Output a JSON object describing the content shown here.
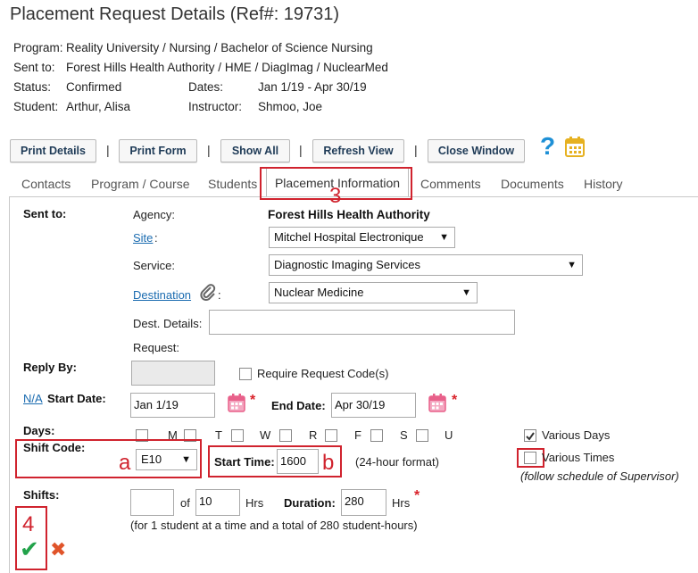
{
  "header": {
    "title": "Placement Request Details (Ref#: 19731)",
    "program_label": "Program:",
    "program_value": "Reality University / Nursing / Bachelor of Science Nursing",
    "sent_label": "Sent to:",
    "sent_value": "Forest Hills Health Authority / HME / DiagImag / NuclearMed",
    "status_label": "Status:",
    "status_value": "Confirmed",
    "dates_label": "Dates:",
    "dates_value": "Jan 1/19 - Apr 30/19",
    "student_label": "Student:",
    "student_value": "Arthur, Alisa",
    "instructor_label": "Instructor:",
    "instructor_value": "Shmoo, Joe"
  },
  "toolbar": {
    "print_details": "Print Details",
    "print_form": "Print Form",
    "show_all": "Show All",
    "refresh_view": "Refresh View",
    "close_window": "Close Window",
    "separator": "|",
    "help_glyph": "?"
  },
  "tabs": [
    "Contacts",
    "Program / Course",
    "Students",
    "Placement Information",
    "Comments",
    "Documents",
    "History"
  ],
  "form": {
    "sent_to_label": "Sent to:",
    "agency_label": "Agency:",
    "agency_value": "Forest Hills Health Authority",
    "site_label": "Site",
    "site_value": "Mitchel Hospital Electronique",
    "service_label": "Service:",
    "service_value": "Diagnostic Imaging Services",
    "destination_label": "Destination",
    "destination_colon": ":",
    "destination_value": "Nuclear Medicine",
    "dest_details_label": "Dest. Details:",
    "dest_details_value": "",
    "request_label": "Request:",
    "reply_by_label": "Reply By:",
    "require_code_label": "Require Request Code(s)",
    "na_link": "N/A",
    "start_date_label": "Start Date:",
    "start_date_value": "Jan 1/19",
    "end_date_label": "End Date:",
    "end_date_value": "Apr 30/19",
    "days_label": "Days:",
    "days": [
      "M",
      "T",
      "W",
      "R",
      "F",
      "S",
      "U"
    ],
    "various_days_label": "Various Days",
    "various_days_checked": true,
    "shift_code_label": "Shift Code:",
    "shift_code_value": "E10",
    "start_time_label": "Start Time:",
    "start_time_value": "1600",
    "time_format": "(24-hour format)",
    "various_times_label": "Various Times",
    "various_times_checked": false,
    "various_times_note": "(follow schedule of Supervisor)",
    "shifts_label": "Shifts:",
    "shifts_value": "",
    "of_label": "of",
    "hours_value": "10",
    "hrs_label": "Hrs",
    "duration_label": "Duration:",
    "duration_value": "280",
    "duration_hrs": "Hrs",
    "summary": "(for 1 student at a time and a total of 280 student-hours)",
    "required_mark": "*",
    "dropdown_arrow": "▼",
    "confirm_glyph": "✔",
    "cancel_glyph": "✖"
  },
  "annotations": {
    "n3": "3",
    "n4": "4",
    "a": "a",
    "b": "b"
  },
  "colors": {
    "annotation_red": "#d0232e",
    "link_blue": "#1a6bb0",
    "calendar_pink": "#e8608a",
    "calendar_gold": "#e6b121",
    "confirm_green": "#22a24a",
    "cancel_orange": "#e0542a"
  }
}
